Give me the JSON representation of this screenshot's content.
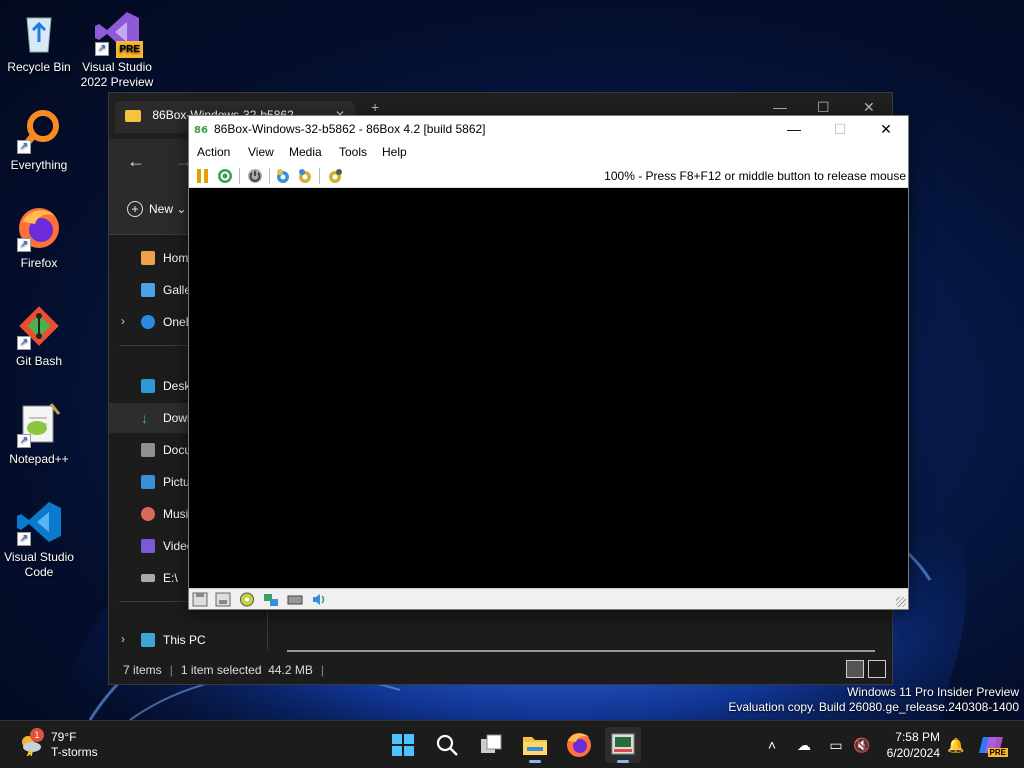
{
  "desktop": {
    "icons": [
      {
        "label": "Recycle Bin"
      },
      {
        "label": "Visual Studio 2022 Preview",
        "badge": "PRE"
      },
      {
        "label": "Everything"
      },
      {
        "label": "Firefox"
      },
      {
        "label": "Git Bash"
      },
      {
        "label": "Notepad++"
      },
      {
        "label": "Visual Studio Code"
      }
    ]
  },
  "explorer": {
    "tab_title": "86Box-Windows-32-b5862",
    "new_label": "New",
    "sidebar": [
      {
        "label": "Home",
        "icon": "home-icon"
      },
      {
        "label": "Gallery",
        "icon": "gallery-icon"
      },
      {
        "label": "OneDrive",
        "icon": "onedrive-icon"
      },
      {
        "label": "Desktop",
        "icon": "desktop-icon"
      },
      {
        "label": "Downloads",
        "icon": "download-icon"
      },
      {
        "label": "Documents",
        "icon": "documents-icon"
      },
      {
        "label": "Pictures",
        "icon": "pictures-icon"
      },
      {
        "label": "Music",
        "icon": "music-icon"
      },
      {
        "label": "Videos",
        "icon": "videos-icon"
      },
      {
        "label": "E:\\",
        "icon": "drive-icon"
      },
      {
        "label": "This PC",
        "icon": "pc-icon"
      }
    ],
    "status": {
      "items": "7 items",
      "selected": "1 item selected",
      "size": "44.2 MB"
    }
  },
  "box86": {
    "title": "86Box-Windows-32-b5862 - 86Box 4.2 [build 5862]",
    "menu": [
      "Action",
      "View",
      "Media",
      "Tools",
      "Help"
    ],
    "status_text": "100% - Press F8+F12 or middle button to release mouse"
  },
  "watermark": {
    "line1": "Windows 11 Pro Insider Preview",
    "line2": "Evaluation copy. Build 26080.ge_release.240308-1400"
  },
  "taskbar": {
    "weather_badge": "1",
    "temperature": "79°F",
    "condition": "T-storms",
    "time": "7:58 PM",
    "date": "6/20/2024",
    "copilot_badge": "PRE"
  },
  "colors": {
    "accent": "#0078d4",
    "wallpaper_bloom": "#1f5bd8"
  }
}
